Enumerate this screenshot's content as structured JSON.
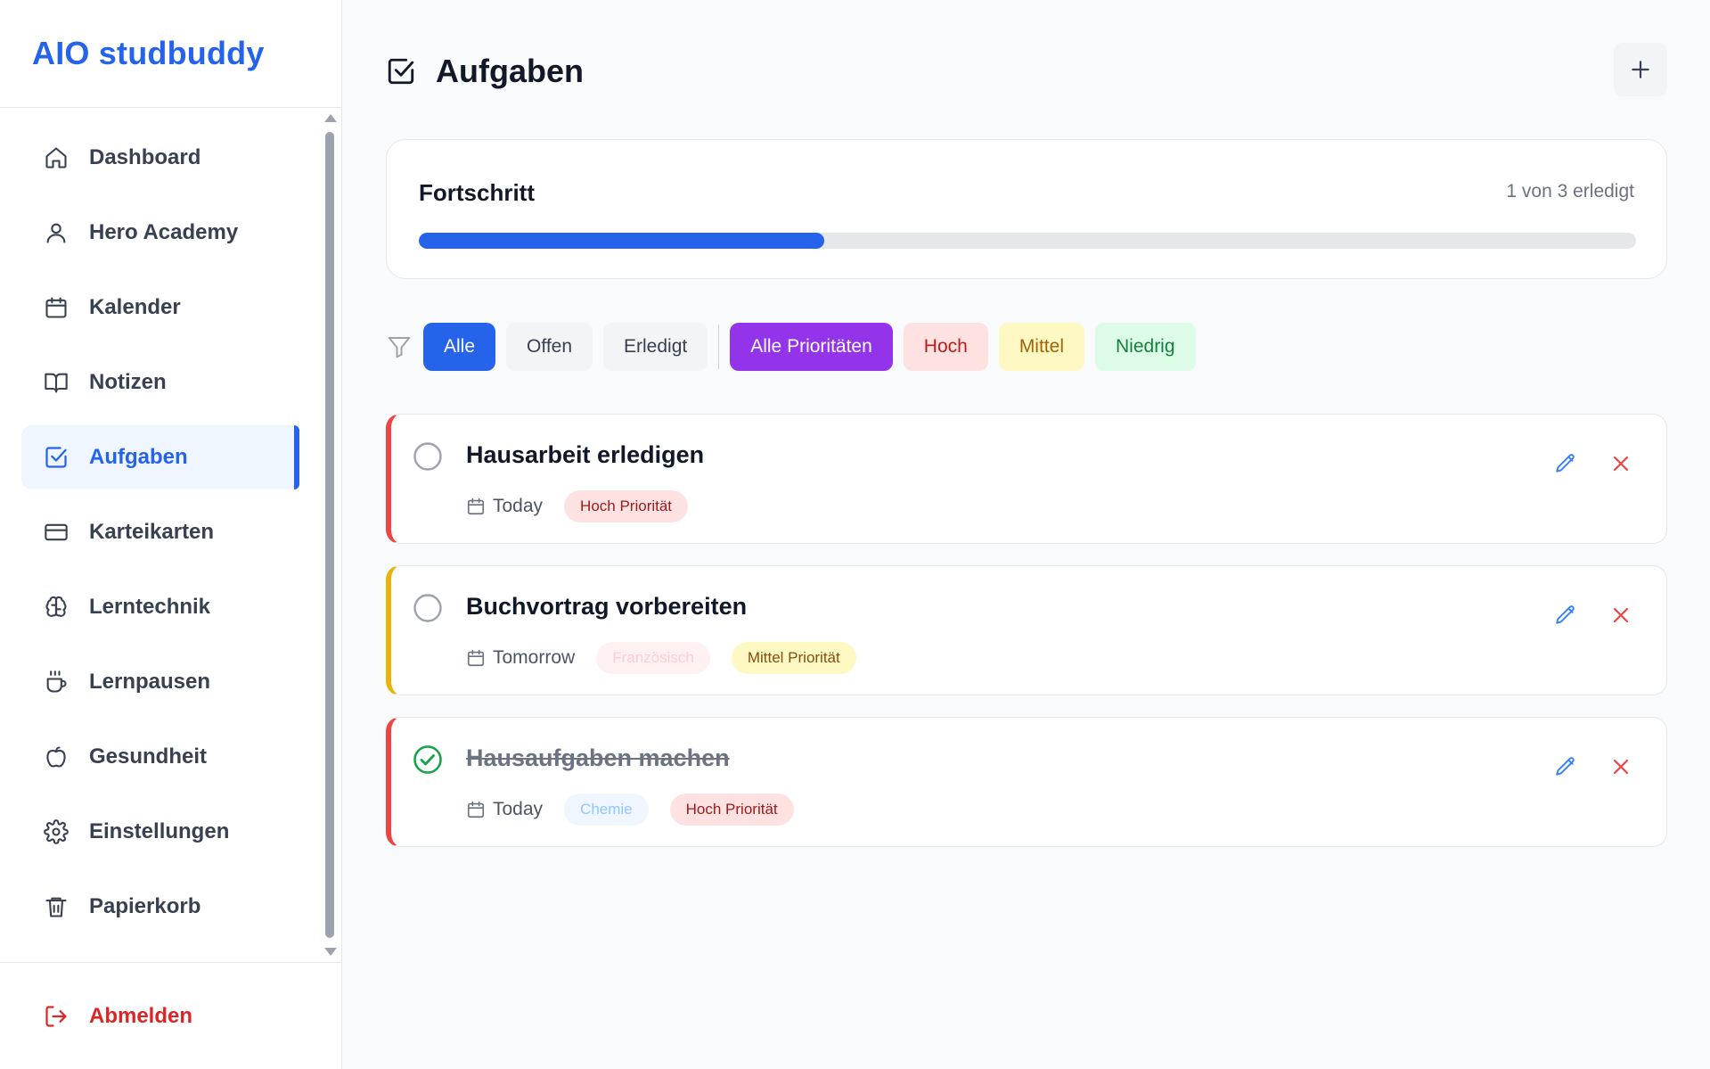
{
  "app": {
    "title": "AIO studbuddy"
  },
  "sidebar": {
    "items": [
      {
        "label": "Dashboard",
        "icon": "home-icon"
      },
      {
        "label": "Hero Academy",
        "icon": "user-icon"
      },
      {
        "label": "Kalender",
        "icon": "calendar-icon"
      },
      {
        "label": "Notizen",
        "icon": "book-open-icon"
      },
      {
        "label": "Aufgaben",
        "icon": "check-square-icon",
        "active": true
      },
      {
        "label": "Karteikarten",
        "icon": "credit-card-icon"
      },
      {
        "label": "Lerntechnik",
        "icon": "brain-icon"
      },
      {
        "label": "Lernpausen",
        "icon": "coffee-icon"
      },
      {
        "label": "Gesundheit",
        "icon": "apple-icon"
      },
      {
        "label": "Einstellungen",
        "icon": "gear-icon"
      },
      {
        "label": "Papierkorb",
        "icon": "trash-icon"
      }
    ],
    "logout_label": "Abmelden"
  },
  "main": {
    "title": "Aufgaben",
    "progress": {
      "title": "Fortschritt",
      "count_text": "1 von 3 erledigt",
      "fraction": 0.333
    },
    "filters": {
      "status": [
        "Alle",
        "Offen",
        "Erledigt"
      ],
      "active_status": "Alle",
      "priority": [
        "Alle Prioritäten",
        "Hoch",
        "Mittel",
        "Niedrig"
      ]
    },
    "tasks": [
      {
        "title": "Hausarbeit erledigen",
        "due": "Today",
        "subject": "",
        "priority_label": "Hoch Priorität",
        "priority": "hoch",
        "done": false
      },
      {
        "title": "Buchvortrag vorbereiten",
        "due": "Tomorrow",
        "subject": "Französisch",
        "priority_label": "Mittel Priorität",
        "priority": "mittel",
        "done": false
      },
      {
        "title": "Hausaufgaben machen",
        "due": "Today",
        "subject": "Chemie",
        "priority_label": "Hoch Priorität",
        "priority": "hoch",
        "done": true
      }
    ]
  },
  "colors": {
    "accent": "#2563eb",
    "purple": "#9333ea",
    "danger": "#ef4444",
    "warning": "#eab308",
    "success": "#16a34a"
  }
}
